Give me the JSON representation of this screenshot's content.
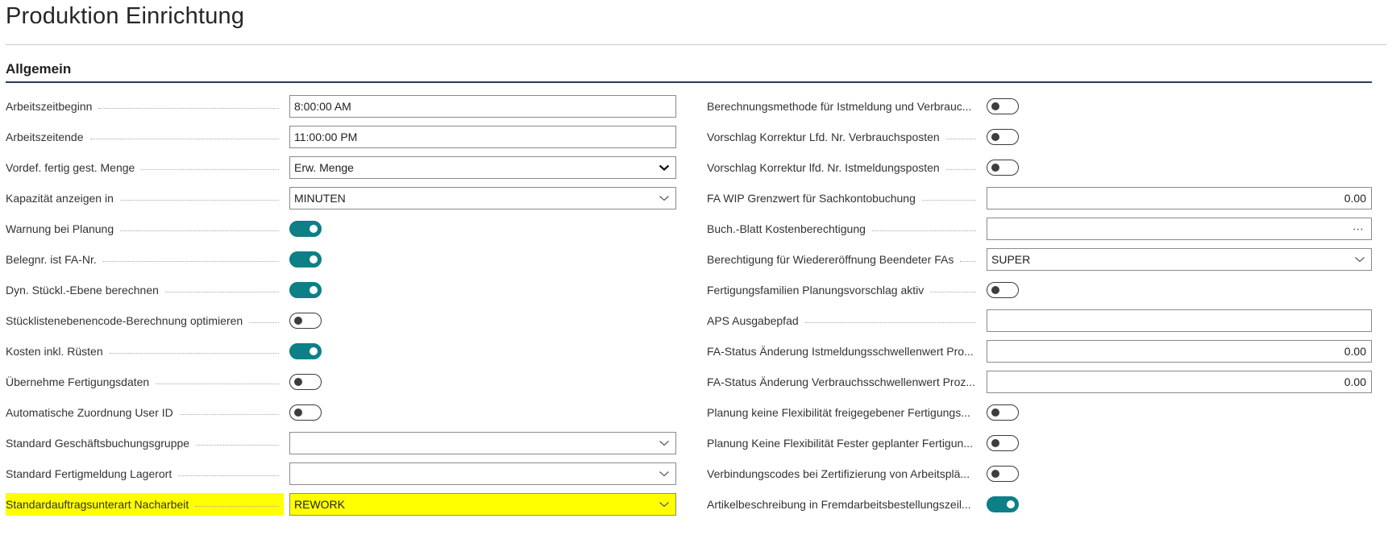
{
  "page": {
    "title": "Produktion Einrichtung",
    "section": "Allgemein"
  },
  "left": [
    {
      "label": "Arbeitszeitbeginn",
      "type": "text",
      "value": "8:00:00 AM"
    },
    {
      "label": "Arbeitszeitende",
      "type": "text",
      "value": "11:00:00 PM"
    },
    {
      "label": "Vordef. fertig gest. Menge",
      "type": "select-native",
      "value": "Erw. Menge"
    },
    {
      "label": "Kapazität anzeigen in",
      "type": "select",
      "value": "MINUTEN"
    },
    {
      "label": "Warnung bei Planung",
      "type": "toggle",
      "on": true
    },
    {
      "label": "Belegnr. ist FA-Nr.",
      "type": "toggle",
      "on": true
    },
    {
      "label": "Dyn. Stückl.-Ebene berechnen",
      "type": "toggle",
      "on": true
    },
    {
      "label": "Stücklistenebenencode-Berechnung optimieren",
      "type": "toggle",
      "on": false
    },
    {
      "label": "Kosten inkl. Rüsten",
      "type": "toggle",
      "on": true
    },
    {
      "label": "Übernehme Fertigungsdaten",
      "type": "toggle",
      "on": false
    },
    {
      "label": "Automatische Zuordnung User ID",
      "type": "toggle",
      "on": false
    },
    {
      "label": "Standard Geschäftsbuchungsgruppe",
      "type": "select",
      "value": ""
    },
    {
      "label": "Standard Fertigmeldung Lagerort",
      "type": "select",
      "value": ""
    },
    {
      "label": "Standardauftragsunterart Nacharbeit",
      "type": "select",
      "value": "REWORK",
      "highlight": true
    }
  ],
  "right": [
    {
      "label": "Berechnungsmethode für Istmeldung und Verbrauc...",
      "type": "toggle",
      "on": false
    },
    {
      "label": "Vorschlag Korrektur Lfd. Nr. Verbrauchsposten",
      "type": "toggle",
      "on": false
    },
    {
      "label": "Vorschlag Korrektur lfd. Nr. Istmeldungsposten",
      "type": "toggle",
      "on": false
    },
    {
      "label": "FA WIP Grenzwert für Sachkontobuchung",
      "type": "number",
      "value": "0.00"
    },
    {
      "label": "Buch.-Blatt Kostenberechtigung",
      "type": "lookup",
      "value": "",
      "ellipsis": "⋯"
    },
    {
      "label": "Berechtigung für Wiedereröffnung Beendeter FAs",
      "type": "select",
      "value": "SUPER"
    },
    {
      "label": "Fertigungsfamilien Planungsvorschlag aktiv",
      "type": "toggle",
      "on": false
    },
    {
      "label": "APS Ausgabepfad",
      "type": "text",
      "value": ""
    },
    {
      "label": "FA-Status Änderung Istmeldungsschwellenwert Pro...",
      "type": "number",
      "value": "0.00"
    },
    {
      "label": "FA-Status Änderung Verbrauchsschwellenwert Proz...",
      "type": "number",
      "value": "0.00"
    },
    {
      "label": "Planung keine Flexibilität freigegebener Fertigungs...",
      "type": "toggle",
      "on": false
    },
    {
      "label": "Planung Keine Flexibilität Fester geplanter Fertigun...",
      "type": "toggle",
      "on": false
    },
    {
      "label": "Verbindungscodes bei Zertifizierung von Arbeitsplä...",
      "type": "toggle",
      "on": false
    },
    {
      "label": "Artikelbeschreibung in Fremdarbeitsbestellungszeil...",
      "type": "toggle",
      "on": true
    }
  ],
  "colors": {
    "toggle_on": "#0d7f86",
    "highlight": "#ffff00",
    "section_rule": "#2b3a55"
  },
  "icons": {
    "dropdown": "chevron-down-icon",
    "native_dropdown": "caret-down-icon",
    "lookup": "ellipsis-icon"
  }
}
